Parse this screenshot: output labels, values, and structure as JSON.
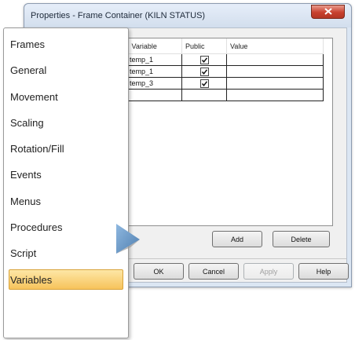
{
  "window": {
    "title": "Properties - Frame Container (KILN STATUS)",
    "close_glyph": "x"
  },
  "nav": {
    "items": [
      {
        "label": "Frames"
      },
      {
        "label": "General"
      },
      {
        "label": "Movement"
      },
      {
        "label": "Scaling"
      },
      {
        "label": "Rotation/Fill"
      },
      {
        "label": "Events"
      },
      {
        "label": "Menus"
      },
      {
        "label": "Procedures"
      },
      {
        "label": "Script"
      },
      {
        "label": "Variables"
      }
    ],
    "selected": "Variables",
    "selected_color": "#f7c35b"
  },
  "table": {
    "headers": [
      "Variable",
      "Public",
      "Value"
    ],
    "rows": [
      {
        "variable": "temp_1",
        "public": true,
        "value": ""
      },
      {
        "variable": "temp_1",
        "public": true,
        "value": ""
      },
      {
        "variable": "temp_3",
        "public": true,
        "value": ""
      },
      {
        "variable": "",
        "public": false,
        "value": ""
      }
    ]
  },
  "buttons": {
    "add": "Add",
    "delete": "Delete",
    "ok": "OK",
    "cancel": "Cancel",
    "apply": "Apply",
    "help": "Help"
  },
  "icons": {
    "close": "close-icon",
    "checkbox": "check-icon",
    "pointer": "arrow-pointer-icon"
  },
  "colors": {
    "dialog_frame": "#dbe6f3",
    "close_button": "#c8412e",
    "pointer": "#6a9ac8"
  }
}
